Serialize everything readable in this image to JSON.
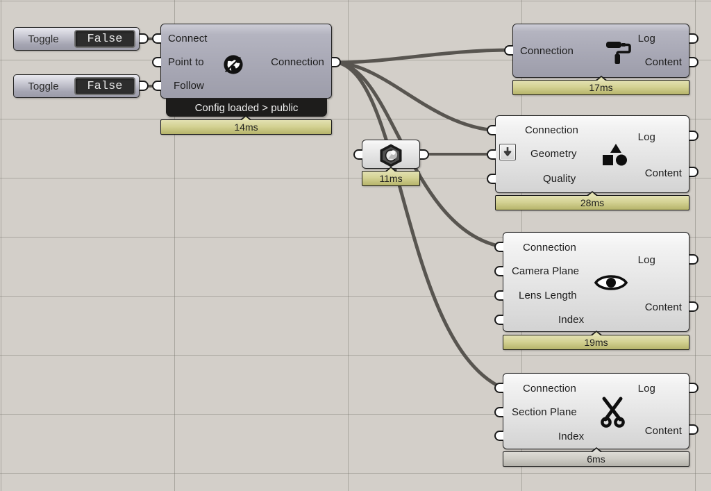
{
  "canvas": {
    "background_color": "#d3cfc9",
    "grid_line_color": "#78756e",
    "wire_color": "#585550"
  },
  "toggles": [
    {
      "name": "Toggle",
      "value": "False"
    },
    {
      "name": "Toggle",
      "value": "False"
    }
  ],
  "nodes": [
    {
      "id": "connect",
      "icon": "globe-icon",
      "selected": true,
      "inputs": [
        "Connect",
        "Point to",
        "Follow"
      ],
      "outputs": [
        "Connection"
      ],
      "runtime_message": "Config loaded > public",
      "timing": "14ms",
      "timing_style": "yellow"
    },
    {
      "id": "geometry-pipe",
      "icon": "hex-nut-icon",
      "selected": false,
      "inputs": [
        ""
      ],
      "outputs": [
        ""
      ],
      "timing": "11ms",
      "timing_style": "yellow"
    },
    {
      "id": "paint",
      "icon": "paint-roller-icon",
      "selected": true,
      "inputs": [
        "Connection"
      ],
      "outputs": [
        "Log",
        "Content"
      ],
      "timing": "17ms",
      "timing_style": "yellow"
    },
    {
      "id": "geometry",
      "icon": "shapes-icon",
      "selected": false,
      "inputs": [
        "Connection",
        "Geometry",
        "Quality"
      ],
      "outputs": [
        "Log",
        "Content"
      ],
      "flatten_on_input": 1,
      "timing": "28ms",
      "timing_style": "yellow"
    },
    {
      "id": "camera",
      "icon": "eye-icon",
      "selected": false,
      "inputs": [
        "Connection",
        "Camera Plane",
        "Lens Length",
        "Index"
      ],
      "outputs": [
        "Log",
        "Content"
      ],
      "timing": "19ms",
      "timing_style": "yellow"
    },
    {
      "id": "section",
      "icon": "scissors-icon",
      "selected": false,
      "inputs": [
        "Connection",
        "Section Plane",
        "Index"
      ],
      "outputs": [
        "Log",
        "Content"
      ],
      "timing": "6ms",
      "timing_style": "grey"
    }
  ]
}
